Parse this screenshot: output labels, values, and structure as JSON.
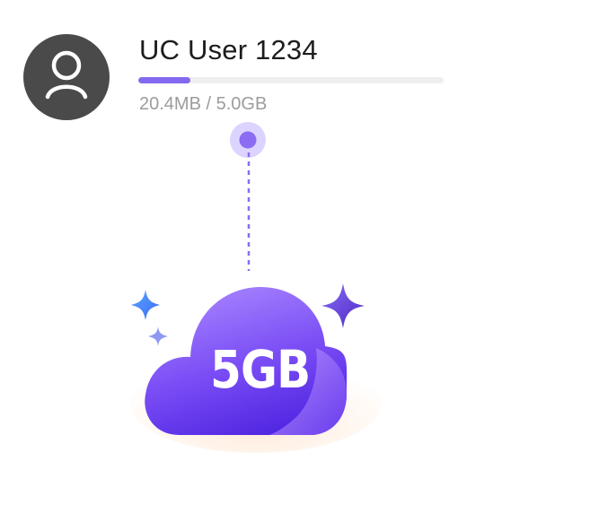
{
  "user": {
    "name": "UC User 1234",
    "usage_text": "20.4MB / 5.0GB",
    "usage_fraction": 0.17
  },
  "cloud": {
    "capacity_label": "5GB"
  },
  "colors": {
    "avatar_bg": "#4a4a4a",
    "accent": "#8468f0",
    "cloud_top": "#a27bff",
    "cloud_bottom": "#5a2de8"
  },
  "icons": {
    "avatar": "user-silhouette-icon",
    "sparkle_left_large": "sparkle-icon",
    "sparkle_left_small": "sparkle-icon",
    "sparkle_right": "sparkle-icon"
  }
}
